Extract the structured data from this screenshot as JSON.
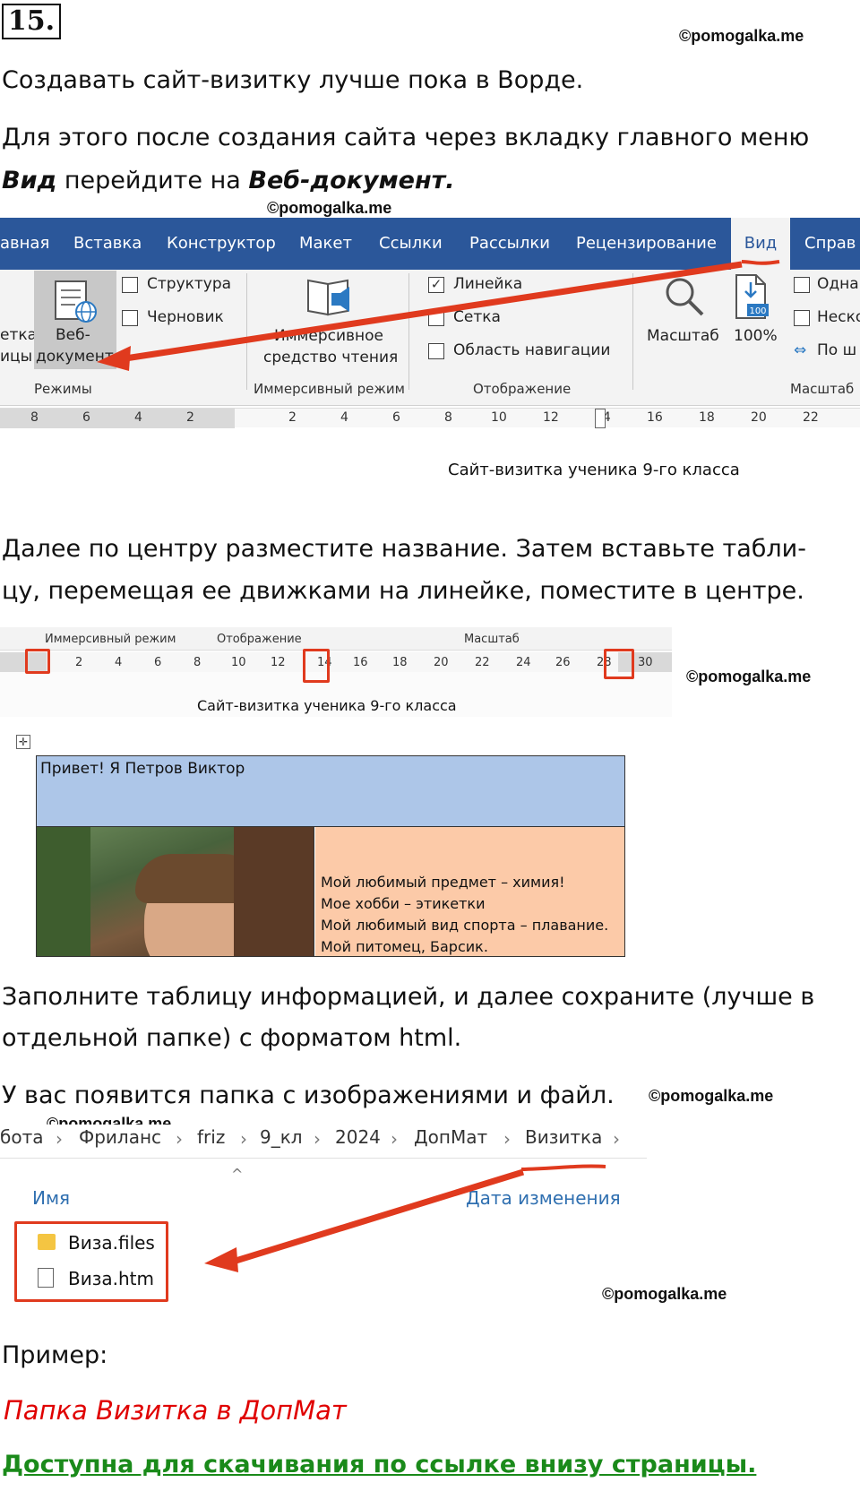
{
  "task_number": "15.",
  "watermark": "©pomogalka.me",
  "paragraphs": {
    "p1": "Создавать сайт-визитку лучше пока в Ворде.",
    "p2_line1": "Для этого после создания сайта через вкладку главного меню",
    "p2_bold1": "Вид",
    "p2_mid": " перейдите на ",
    "p2_bold2": "Веб-документ.",
    "p3_line1": "Далее по центру разместите название. Затем вставьте табли-",
    "p3_line2": "цу, перемещая ее движками на линейке, поместите в центре.",
    "p4_line1": "Заполните таблицу информацией, и далее сохраните (лучше в",
    "p4_line2": "отдельной папке) с форматом html.",
    "p5": "У вас появится папка с изображениями и файл.",
    "example_label": "Пример:",
    "example_link_a": "Па",
    "example_link_b": "пка Визитка в ДопМат",
    "download_note": "Доступна для скачивания по ссылке внизу страницы."
  },
  "ribbon": {
    "tabs": [
      "авная",
      "Вставка",
      "Конструктор",
      "Макет",
      "Ссылки",
      "Рассылки",
      "Рецензирование",
      "Вид",
      "Справ"
    ],
    "active_tab": "Вид",
    "left_cut_label1": "етка",
    "left_cut_label2": "ицы",
    "web_doc_line1": "Веб-",
    "web_doc_line2": "документ",
    "structure": "Структура",
    "draft": "Черновик",
    "immersive_line1": "Иммерсивное",
    "immersive_line2": "средство чтения",
    "ruler_check": "Линейка",
    "grid_check": "Сетка",
    "nav_check": "Область навигации",
    "zoom": "Масштаб",
    "zoom100": "100%",
    "zoom100_badge": "100",
    "one_page": "Одна",
    "multi_page": "Неско",
    "page_width": "По ш",
    "group_modes": "Режимы",
    "group_immersive": "Иммерсивный режим",
    "group_display": "Отображение",
    "group_zoom": "Масштаб",
    "ruler_left": [
      "8",
      "6",
      "4",
      "2"
    ],
    "ruler_right": [
      "2",
      "4",
      "6",
      "8",
      "10",
      "12",
      "14",
      "16",
      "18",
      "20",
      "22"
    ]
  },
  "doc_title": "Сайт-визитка ученика 9-го класса",
  "ruler2": {
    "groups": [
      "Иммерсивный режим",
      "Отображение",
      "Масштаб"
    ],
    "ticks": [
      "2",
      "4",
      "6",
      "8",
      "10",
      "12",
      "14",
      "16",
      "18",
      "20",
      "22",
      "24",
      "26",
      "28",
      "30"
    ]
  },
  "web_table": {
    "header": "Привет! Я Петров Виктор",
    "info_lines": [
      "Мой любимый предмет – химия!",
      "Мое хобби – этикетки",
      "Мой любимый вид спорта – плавание.",
      "Мой питомец, Барсик."
    ]
  },
  "explorer": {
    "breadcrumb": [
      "бота",
      "Фриланс",
      "friz",
      "9_кл",
      "2024",
      "ДопМат",
      "Визитка"
    ],
    "col_name": "Имя",
    "col_date": "Дата изменения",
    "files": [
      "Виза.files",
      "Виза.htm"
    ]
  },
  "colors": {
    "ribbon_blue": "#2b579a",
    "arrow_red": "#e03a1e",
    "link_red": "#e00000",
    "link_green": "#1a8a1a",
    "table_header": "#adc6e8",
    "table_info": "#fccaa8"
  }
}
